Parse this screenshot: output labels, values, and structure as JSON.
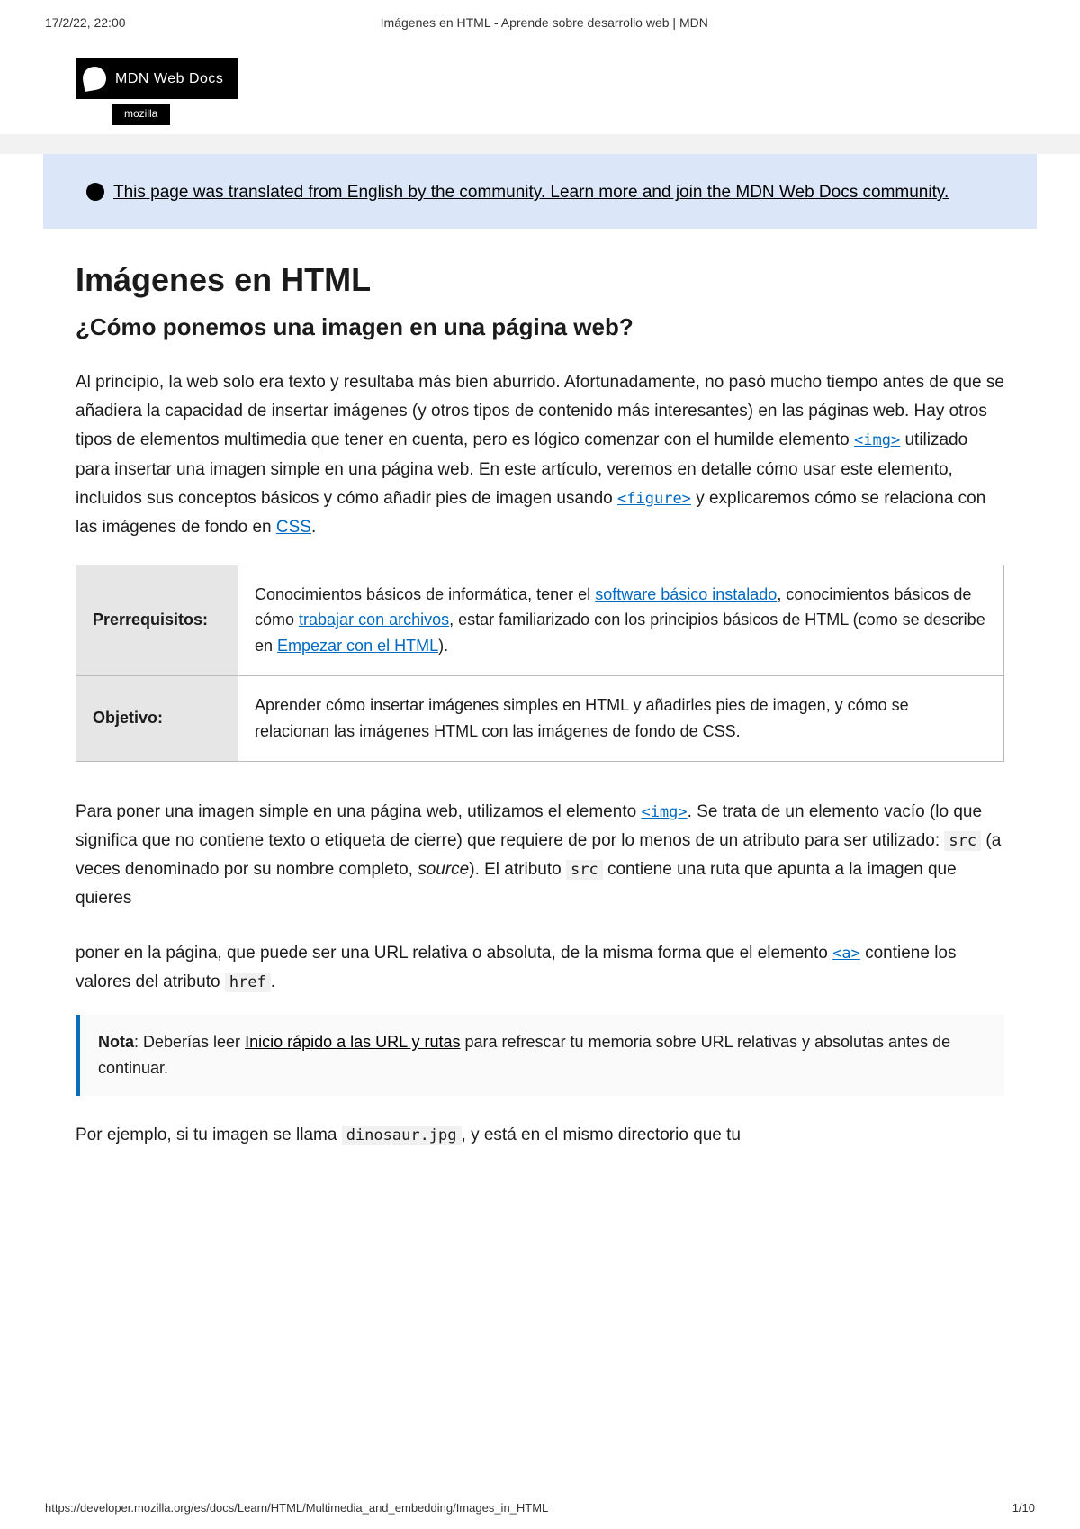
{
  "header": {
    "datetime": "17/2/22, 22:00",
    "title": "Imágenes en HTML - Aprende sobre desarrollo web | MDN"
  },
  "logo": {
    "text": "MDN Web Docs",
    "subtext": "mozilla"
  },
  "banner": {
    "text": "This page was translated from English by the community. Learn more and join the MDN Web Docs community."
  },
  "page": {
    "h1": "Imágenes en HTML",
    "h2": "¿Cómo ponemos una imagen en una página web?"
  },
  "intro": {
    "p1_a": "Al principio, la web solo era texto y resultaba más bien aburrido. Afortunadamente, no pasó mucho tiempo antes de que se añadiera la capacidad de insertar imágenes (y otros tipos de contenido más interesantes) en las páginas web. Hay otros tipos de elementos multimedia que tener en cuenta, pero es lógico comenzar con el humilde elemento ",
    "code_img": "<img>",
    "p1_b": " utilizado para insertar una imagen simple en una página web. En este artículo, veremos en detalle cómo usar este elemento, incluidos sus conceptos básicos y cómo añadir pies de imagen usando ",
    "code_figure": "<figure>",
    "p1_c": " y explicaremos cómo se relaciona con las imágenes de fondo en ",
    "css_link": "CSS",
    "p1_d": "."
  },
  "table": {
    "row1": {
      "label": "Prerrequisitos:",
      "t1": "Conocimientos básicos de informática, tener el ",
      "link1": "software básico instalado",
      "t2": ", conocimientos básicos de cómo ",
      "link2": "trabajar con archivos",
      "t3": ", estar familiarizado con los principios básicos de HTML (como se describe en ",
      "link3": "Empezar con el HTML",
      "t4": ")."
    },
    "row2": {
      "label": "Objetivo:",
      "text": "Aprender cómo insertar imágenes simples en HTML y añadirles pies de imagen, y cómo se relacionan las imágenes HTML con las imágenes de fondo de CSS."
    }
  },
  "body": {
    "p2_a": "Para poner una imagen simple en una página web, utilizamos el elemento ",
    "code_img2": "<img>",
    "p2_b": ". Se trata de un elemento vacío (lo que significa que no contiene texto o etiqueta de cierre) que requiere de por lo menos de un atributo para ser utilizado: ",
    "code_src": "src",
    "p2_c": " (a veces denominado por su nombre completo, ",
    "source": "source",
    "p2_d": "). El atributo ",
    "code_src2": "src",
    "p2_e": " contiene una ruta que apunta a la imagen que quieres",
    "p3_a": "poner en la página, que puede ser una URL relativa o absoluta, de la misma forma que el elemento ",
    "code_a": "<a>",
    "p3_b": " contiene los valores del atributo ",
    "code_href": "href",
    "p3_c": "."
  },
  "note": {
    "label": "Nota",
    "t1": ": Deberías leer ",
    "link": "Inicio rápido a las URL y rutas",
    "t2": " para refrescar tu memoria sobre URL relativas y absolutas antes de continuar."
  },
  "final": {
    "p_a": "Por ejemplo, si tu imagen se llama ",
    "code": "dinosaur.jpg",
    "p_b": ", y está en el mismo directorio que tu"
  },
  "footer": {
    "url": "https://developer.mozilla.org/es/docs/Learn/HTML/Multimedia_and_embedding/Images_in_HTML",
    "pagenum": "1/10"
  }
}
